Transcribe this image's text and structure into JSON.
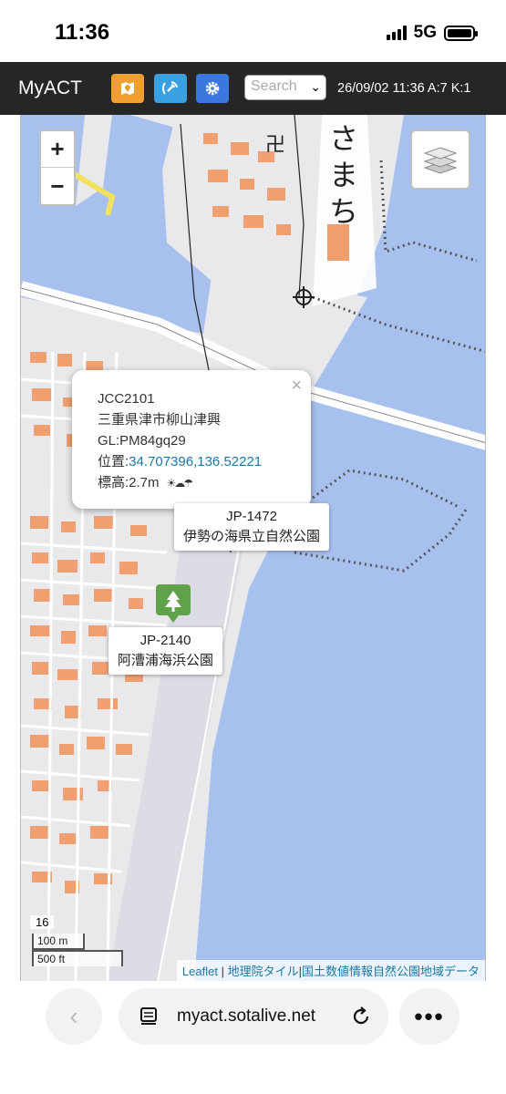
{
  "status_bar": {
    "time": "11:36",
    "network": "5G"
  },
  "header": {
    "title": "MyACT",
    "buttons": [
      {
        "icon": "map-pin-icon",
        "color": "#f0a030"
      },
      {
        "icon": "satellite-icon",
        "color": "#3aa0e0"
      },
      {
        "icon": "gear-icon",
        "color": "#3a78e0"
      }
    ],
    "search_placeholder": "Search",
    "status_text": "26/09/02 11:36 A:7 K:1"
  },
  "map": {
    "zoom_in": "+",
    "zoom_out": "−",
    "big_label": [
      "さ",
      "ま",
      "ち"
    ],
    "popup": {
      "close": "×",
      "line1": "JCC2101",
      "line2": "三重県津市柳山津興",
      "line3": "GL:PM84gq29",
      "coord_label": "位置:",
      "coord_value": "34.707396,136.52221",
      "elev": "標高:2.7m",
      "weather": "☀☁☂"
    },
    "tooltips": [
      {
        "code": "JP-1472",
        "name": "伊勢の海県立自然公園"
      },
      {
        "code": "JP-2140",
        "name": "阿漕浦海浜公園"
      }
    ],
    "zoom_level": "16",
    "scale_m": "100 m",
    "scale_ft": "500 ft",
    "attribution": {
      "leaflet": "Leaflet",
      "sep": " | ",
      "gsi": "地理院タイル",
      "pipe": "|",
      "data": "国土数値情報自然公園地域データ"
    },
    "colors": {
      "water": "#a7c0ee",
      "land": "#e9e9ec",
      "building": "#f0a070",
      "road": "#ffffff"
    }
  },
  "browser": {
    "url": "myact.sotalive.net",
    "back": "‹",
    "more": "•••"
  }
}
